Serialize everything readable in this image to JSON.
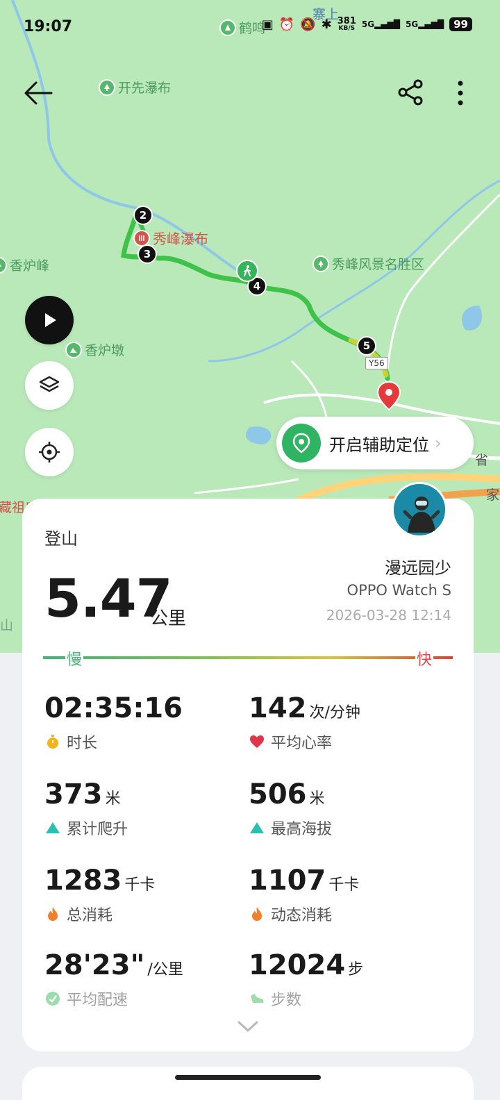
{
  "status_bar": {
    "time": "19:07",
    "poi_name": "鹤鸣",
    "village": "寨上",
    "net_speed": "381",
    "net_unit": "KB/S",
    "sig1": "5G",
    "sig2": "5G",
    "battery": "99"
  },
  "map": {
    "pois": {
      "kaixian": "开先瀑布",
      "xiufeng_fall": "秀峰瀑布",
      "xianglu_peak": "香炉峰",
      "xiufeng_area": "秀峰风景名胜区",
      "xianglu_dun": "香炉墩"
    },
    "edge_label_1": "藏祖庙",
    "edge_label_2": "省",
    "edge_label_3": "家",
    "edge_label_4": "山",
    "road_sign": "Y56",
    "markers": [
      "2",
      "3",
      "4",
      "5"
    ],
    "assist_label": "开启辅助定位",
    "icons": {
      "back": "arrow-left-icon",
      "share": "share-icon",
      "more": "more-vertical-icon",
      "play": "play-icon",
      "layers": "layers-icon",
      "locate": "locate-icon",
      "assist": "location-pin-icon"
    }
  },
  "summary": {
    "activity_type": "登山",
    "distance": "5.47",
    "distance_unit": "公里",
    "user_name": "漫远园少",
    "device": "OPPO Watch S",
    "datetime": "2026-03-28 12:14",
    "speed_slow": "慢",
    "speed_fast": "快"
  },
  "stats": {
    "duration": {
      "value": "02:35:16",
      "unit": "",
      "label": "时长"
    },
    "heart_rate": {
      "value": "142",
      "unit": "次/分钟",
      "label": "平均心率"
    },
    "ascent": {
      "value": "373",
      "unit": "米",
      "label": "累计爬升"
    },
    "max_altitude": {
      "value": "506",
      "unit": "米",
      "label": "最高海拔"
    },
    "total_cal": {
      "value": "1283",
      "unit": "千卡",
      "label": "总消耗"
    },
    "active_cal": {
      "value": "1107",
      "unit": "千卡",
      "label": "动态消耗"
    },
    "pace": {
      "value": "28'23\"",
      "unit": "/公里",
      "label": "平均配速"
    },
    "steps": {
      "value": "12024",
      "unit": "步",
      "label": "步数"
    }
  },
  "colors": {
    "map_bg": "#b9e8b9",
    "route_green": "#3ec24a",
    "accent_green": "#2fb463",
    "heart_red": "#e0364a",
    "ascent_teal": "#2bbfb3",
    "flame_orange": "#f27f2a",
    "timer_yellow": "#f3b41b"
  }
}
